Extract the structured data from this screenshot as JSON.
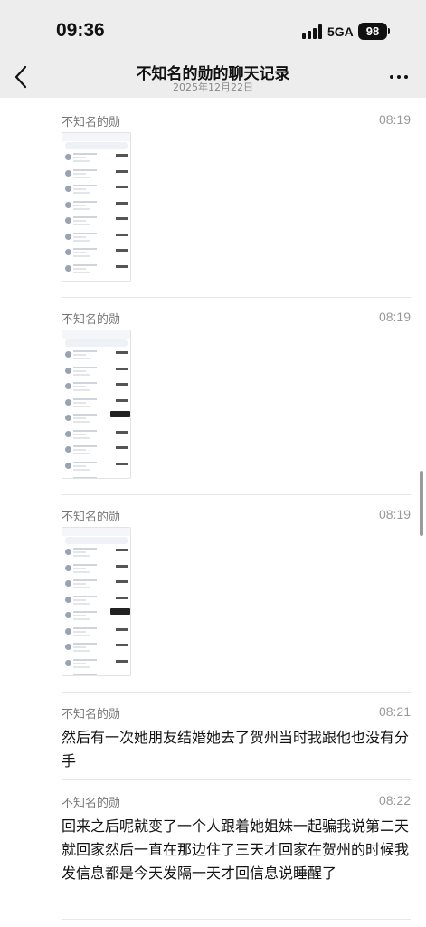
{
  "status_bar": {
    "time": "09:36",
    "network": "5GA",
    "battery": "98"
  },
  "header": {
    "title": "不知名的勋的聊天记录",
    "subtitle": "2025年12月22日",
    "back_icon": "chevron-left-icon",
    "more_icon": "more-dots-icon"
  },
  "messages": [
    {
      "sender": "不知名的勋",
      "time": "08:19",
      "type": "image"
    },
    {
      "sender": "不知名的勋",
      "time": "08:19",
      "type": "image"
    },
    {
      "sender": "不知名的勋",
      "time": "08:19",
      "type": "image"
    },
    {
      "sender": "不知名的勋",
      "time": "08:21",
      "type": "text",
      "text": "然后有一次她朋友结婚她去了贺州当时我跟他也没有分手"
    },
    {
      "sender": "不知名的勋",
      "time": "08:22",
      "type": "text",
      "text": "回来之后呢就变了一个人跟着她姐妹一起骗我说第二天就回家然后一直在那边住了三天才回家在贺州的时候我发信息都是今天发隔一天才回信息说睡醒了"
    }
  ]
}
